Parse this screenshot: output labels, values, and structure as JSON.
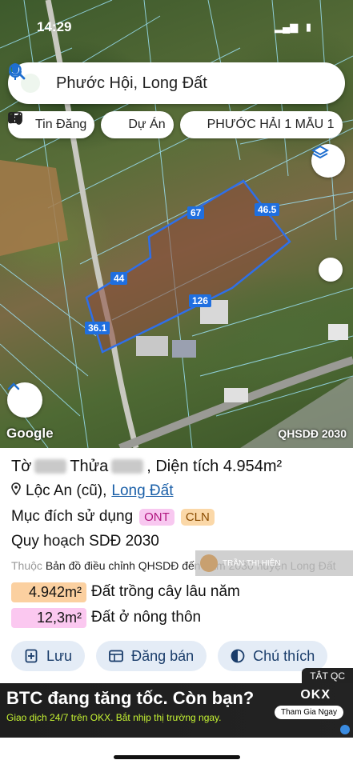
{
  "status": {
    "time": "14:29"
  },
  "search": {
    "place": "Phước Hội, Long Đất"
  },
  "chips": [
    {
      "label": "Tin Đăng",
      "icon": "listing-icon"
    },
    {
      "label": "Dự Án",
      "icon": "buildings-icon"
    },
    {
      "label": "PHƯỚC HẢI 1 MẪU 1",
      "icon": "percent-tag-icon"
    }
  ],
  "map": {
    "dimensions": {
      "top": "67",
      "right": "46.5",
      "left_upper": "44",
      "bottom": "126",
      "left_lower": "36.1"
    },
    "attribution": "Google",
    "layer_label": "QHSDĐ 2030"
  },
  "parcel": {
    "title_to": "Tờ",
    "title_thua": "Thửa",
    "title_area_label": ", Diện tích ",
    "title_area": "4.954m²",
    "location": "Lộc An (cũ),",
    "location_link": "Long Đất",
    "purpose_label": "Mục đích sử dụng",
    "purpose_tags": [
      "ONT",
      "CLN"
    ],
    "plan": "Quy hoạch SDĐ 2030",
    "belong_prefix": "Thuộc",
    "belong_text": "Bản đồ điều chỉnh QHSDĐ đến năm 2030 huyện Long Đất",
    "author": "TRẦN THỊ HIỀN",
    "areas": [
      {
        "value": "4.942m²",
        "label": "Đất trồng cây lâu năm"
      },
      {
        "value": "12,3m²",
        "label": "Đất ở nông thôn"
      }
    ]
  },
  "actions": {
    "save": "Lưu",
    "post": "Đăng bán",
    "note": "Chú thích"
  },
  "ad": {
    "close": "TẮT QC",
    "headline": "BTC đang tăng tốc. Còn bạn?",
    "sub": "Giao dịch 24/7 trên OKX. Bắt nhịp thị trường ngay.",
    "brand": "OKX",
    "cta": "Tham Gia Ngay"
  },
  "colors": {
    "parcel_outline": "#2f6fe8",
    "accent_link": "#1a5fa8",
    "ont": "#f8c8f0",
    "cln": "#fbd8a8"
  }
}
